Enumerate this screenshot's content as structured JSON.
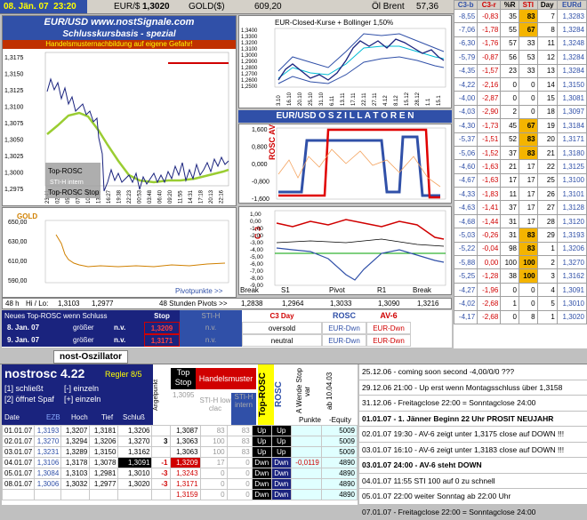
{
  "topbar": {
    "date": "08. Jän. 07",
    "time": "23:20",
    "pair": "EUR/$",
    "price": "1,3020",
    "gold_label": "GOLD($)",
    "gold": "609,20",
    "oil_label": "Öl Brent",
    "oil": "57,36"
  },
  "main": {
    "title": "EUR/USD   www.nostSignale.com",
    "subtitle": "Schlusskursbasis - spezial",
    "warning": "Handelsmusternachbildung auf eigene Gefahr!",
    "yticks": [
      "1,3175",
      "1,3150",
      "1,3125",
      "1,3100",
      "1,3075",
      "1,3050",
      "1,3025",
      "1,3000",
      "1,2975"
    ],
    "xticks": [
      "23:41",
      "02:18",
      "05:13",
      "07:56",
      "10:48",
      "13:48",
      "16:27",
      "19:38",
      "22:23",
      "00:53",
      "03:48",
      "06:40",
      "09:20",
      "11:55",
      "14:31",
      "17:18",
      "20:13",
      "22:16"
    ],
    "legend": [
      "Top-ROSC",
      "STI-H intern",
      "Top-ROSC Stop"
    ]
  },
  "bollinger": {
    "title": "EUR-Closed-Kurse + Bollinger 1,50%",
    "yticks": [
      "1,3400",
      "1,3300",
      "1,3200",
      "1,3100",
      "1,3000",
      "1,2900",
      "1,2800",
      "1,2700",
      "1,2600",
      "1,2500"
    ],
    "xticks": [
      "3.10",
      "16.10",
      "20.10",
      "25.10",
      "31.10",
      "6.11",
      "13.11",
      "17.11",
      "22.11",
      "27.11",
      "4.12",
      "8.12",
      "15.12",
      "28.12",
      "1.1",
      "15.1"
    ]
  },
  "osc": {
    "title": "EUR/USD  O S Z I L L A T O R E N",
    "label1": "ROSC  AV-6",
    "y1": [
      "1,600",
      "0,800",
      "0,000",
      "-0,800",
      "-1,600"
    ],
    "label2": "C 3",
    "y2": [
      "1,00",
      "0,00",
      "-1,00",
      "-2,00",
      "-3,00",
      "-4,00",
      "-5,00",
      "-6,00",
      "-7,00",
      "-8,00",
      "-9,00"
    ]
  },
  "gold": {
    "title": "GOLD",
    "yticks": [
      "650,00",
      "630,00",
      "610,00",
      "590,00"
    ],
    "pivot_link": "Pivotpunkte >>"
  },
  "pivot": {
    "hl_label": "48 h",
    "hl_text": "Hi / Lo:",
    "hi": "1,3103",
    "lo": "1,2977",
    "hours": "48 Stunden Pivots >>",
    "cols": [
      "Break",
      "S1",
      "Pivot",
      "R1",
      "Break"
    ],
    "vals": [
      "1,2838",
      "1,2964",
      "1,3033",
      "1,3090",
      "1,3216"
    ]
  },
  "signals": {
    "head": [
      "Neues Top-ROSC wenn Schluss",
      "Stop",
      "STI-H",
      "C3  Day",
      "ROSC",
      "AV-6"
    ],
    "rows": [
      {
        "date": "8. Jan. 07",
        "cmp": "größer",
        "nv": "n.v.",
        "stop": "1,3209",
        "sti": "n.v.",
        "c3": "oversold",
        "rosc": "EUR-Dwn",
        "av": "EUR-Dwn"
      },
      {
        "date": "9. Jan. 07",
        "cmp": "größer",
        "nv": "n.v.",
        "stop": "1,3171",
        "sti": "n.v.",
        "c3": "neutral",
        "rosc": "EUR-Dwn",
        "av": "EUR-Dwn"
      }
    ]
  },
  "tab": {
    "label": "nost-Oszillator"
  },
  "rightgrid": {
    "head": [
      "C3-b",
      "C3-r",
      "%R",
      "STI",
      "Day",
      "EURd"
    ],
    "rows": [
      [
        "-8,55",
        "-0,83",
        "35",
        "83",
        "7",
        "1,3283"
      ],
      [
        "-7,06",
        "-1,78",
        "55",
        "67",
        "8",
        "1,3284"
      ],
      [
        "-6,30",
        "-1,76",
        "57",
        "33",
        "11",
        "1,3248"
      ],
      [
        "-5,79",
        "-0,87",
        "56",
        "53",
        "12",
        "1,3284"
      ],
      [
        "-4,35",
        "-1,57",
        "23",
        "33",
        "13",
        "1,3284"
      ],
      [
        "-4,22",
        "-2,16",
        "0",
        "0",
        "14",
        "1,3150"
      ],
      [
        "-4,00",
        "-2,87",
        "0",
        "0",
        "15",
        "1,3081"
      ],
      [
        "-4,03",
        "-2,90",
        "2",
        "0",
        "18",
        "1,3097"
      ],
      [
        "-4,30",
        "-1,73",
        "45",
        "67",
        "19",
        "1,3184"
      ],
      [
        "-5,37",
        "-1,51",
        "52",
        "83",
        "20",
        "1,3171"
      ],
      [
        "-5,06",
        "-1,52",
        "37",
        "83",
        "21",
        "1,3180"
      ],
      [
        "-4,60",
        "-1,63",
        "21",
        "17",
        "22",
        "1,3125"
      ],
      [
        "-4,67",
        "-1,63",
        "17",
        "17",
        "25",
        "1,3100"
      ],
      [
        "-4,33",
        "-1,83",
        "11",
        "17",
        "26",
        "1,3101"
      ],
      [
        "-4,63",
        "-1,41",
        "37",
        "17",
        "27",
        "1,3128"
      ],
      [
        "-4,68",
        "-1,44",
        "31",
        "17",
        "28",
        "1,3120"
      ],
      [
        "-5,03",
        "-0,26",
        "31",
        "83",
        "29",
        "1,3193"
      ],
      [
        "-5,22",
        "-0,04",
        "98",
        "83",
        "1",
        "1,3206"
      ],
      [
        "-5,88",
        "0,00",
        "100",
        "100",
        "2",
        "1,3270"
      ],
      [
        "-5,25",
        "-1,28",
        "38",
        "100",
        "3",
        "1,3162"
      ],
      [
        "-4,27",
        "-1,96",
        "0",
        "0",
        "4",
        "1,3091"
      ],
      [
        "-4,02",
        "-2,68",
        "1",
        "0",
        "5",
        "1,3010"
      ],
      [
        "-4,17",
        "-2,68",
        "0",
        "8",
        "1",
        "1,3020"
      ]
    ]
  },
  "bottom": {
    "title": "nostrosc 4.22",
    "regler": "Regler 8/5",
    "opt1": "[1] schließt",
    "opt1b": "[-] einzeln",
    "opt2": "[2] öffnet Spaf",
    "opt2b": "[+] einzeln",
    "cols": [
      "Date",
      "EZB",
      "Hoch",
      "Tief",
      "Schluß"
    ],
    "side": [
      "Angelpunkt",
      "Top Stop",
      "Handelsmuster",
      "STI-H low clac",
      "STI-H intern",
      "Top-ROSC",
      "ROSC",
      "A Wende Stop var",
      "ab 10.04.03"
    ],
    "endcols": [
      "Punkte",
      "-Equity"
    ],
    "ghost": "1,3095",
    "rows": [
      {
        "date": "01.01.07",
        "ezb": "1,3193",
        "hoch": "1,3207",
        "tief": "1,3181",
        "schl": "1,3206",
        "ang": "",
        "stop": "1,3087",
        "h": "83",
        "s": "83",
        "tr": "Up",
        "rosc": "Up",
        "pkt": "",
        "eq": "5009"
      },
      {
        "date": "02.01.07",
        "ezb": "1,3270",
        "hoch": "1,3294",
        "tief": "1,3206",
        "schl": "1,3270",
        "ang": "3",
        "stop": "1,3063",
        "h": "100",
        "s": "83",
        "tr": "Up",
        "rosc": "Up",
        "pkt": "",
        "eq": "5009"
      },
      {
        "date": "03.01.07",
        "ezb": "1,3231",
        "hoch": "1,3289",
        "tief": "1,3150",
        "schl": "1,3162",
        "ang": "",
        "stop": "1,3063",
        "h": "100",
        "s": "83",
        "tr": "Up",
        "rosc": "Up",
        "pkt": "",
        "eq": "5009"
      },
      {
        "date": "04.01.07",
        "ezb": "1,3106",
        "hoch": "1,3178",
        "tief": "1,3078",
        "schl": "1,3091",
        "ang": "-1",
        "stop": "1,3209",
        "h": "17",
        "s": "0",
        "tr": "Dwn",
        "rosc": "Dwn",
        "pkt": "-0,0119",
        "eq": "4890"
      },
      {
        "date": "05.01.07",
        "ezb": "1,3084",
        "hoch": "1,3103",
        "tief": "1,2981",
        "schl": "1,3010",
        "ang": "-3",
        "stop": "1,3243",
        "h": "0",
        "s": "0",
        "tr": "Dwn",
        "rosc": "Dwn",
        "pkt": "",
        "eq": "4890"
      },
      {
        "date": "08.01.07",
        "ezb": "1,3006",
        "hoch": "1,3032",
        "tief": "1,2977",
        "schl": "1,3020",
        "ang": "-3",
        "stop": "1,3171",
        "h": "0",
        "s": "0",
        "tr": "Dwn",
        "rosc": "Dwn",
        "pkt": "",
        "eq": "4890"
      },
      {
        "date": "",
        "ezb": "",
        "hoch": "",
        "tief": "",
        "schl": "",
        "ang": "",
        "stop": "1,3159",
        "h": "0",
        "s": "0",
        "tr": "Dwn",
        "rosc": "Dwn",
        "pkt": "",
        "eq": "4890"
      }
    ]
  },
  "news": [
    "25.12.06 - coming soon second -4,00/0/0 ???",
    "29.12.06 21:00 - Up erst wenn Montagsschluss über 1,3158",
    "31.12.06 - Freitagclose 22:00 = Sonntagclose 24:00",
    "01.01.07 - 1. Jänner Beginn 22 Uhr  PROSIT NEUJAHR",
    "02.01.07 19:30 - AV-6 zeigt unter 1,3175 close auf DOWN !!!",
    "03.01.07 16:10 - AV-6 zeigt unter 1,3183 close auf DOWN !!!",
    "03.01.07 24:00 - AV-6 steht DOWN",
    "04.01.07 11:55 STI 100 auf 0 zu schnell",
    "05.01.07 22:00 weiter Sonntag ab 22:00 Uhr",
    "07.01.07 - Freitagclose 22:00 = Sonntagclose 24:00"
  ],
  "colors": {
    "blue": "#3050a8",
    "red": "#d00000",
    "green": "#00a000",
    "olive": "#9acd32"
  }
}
